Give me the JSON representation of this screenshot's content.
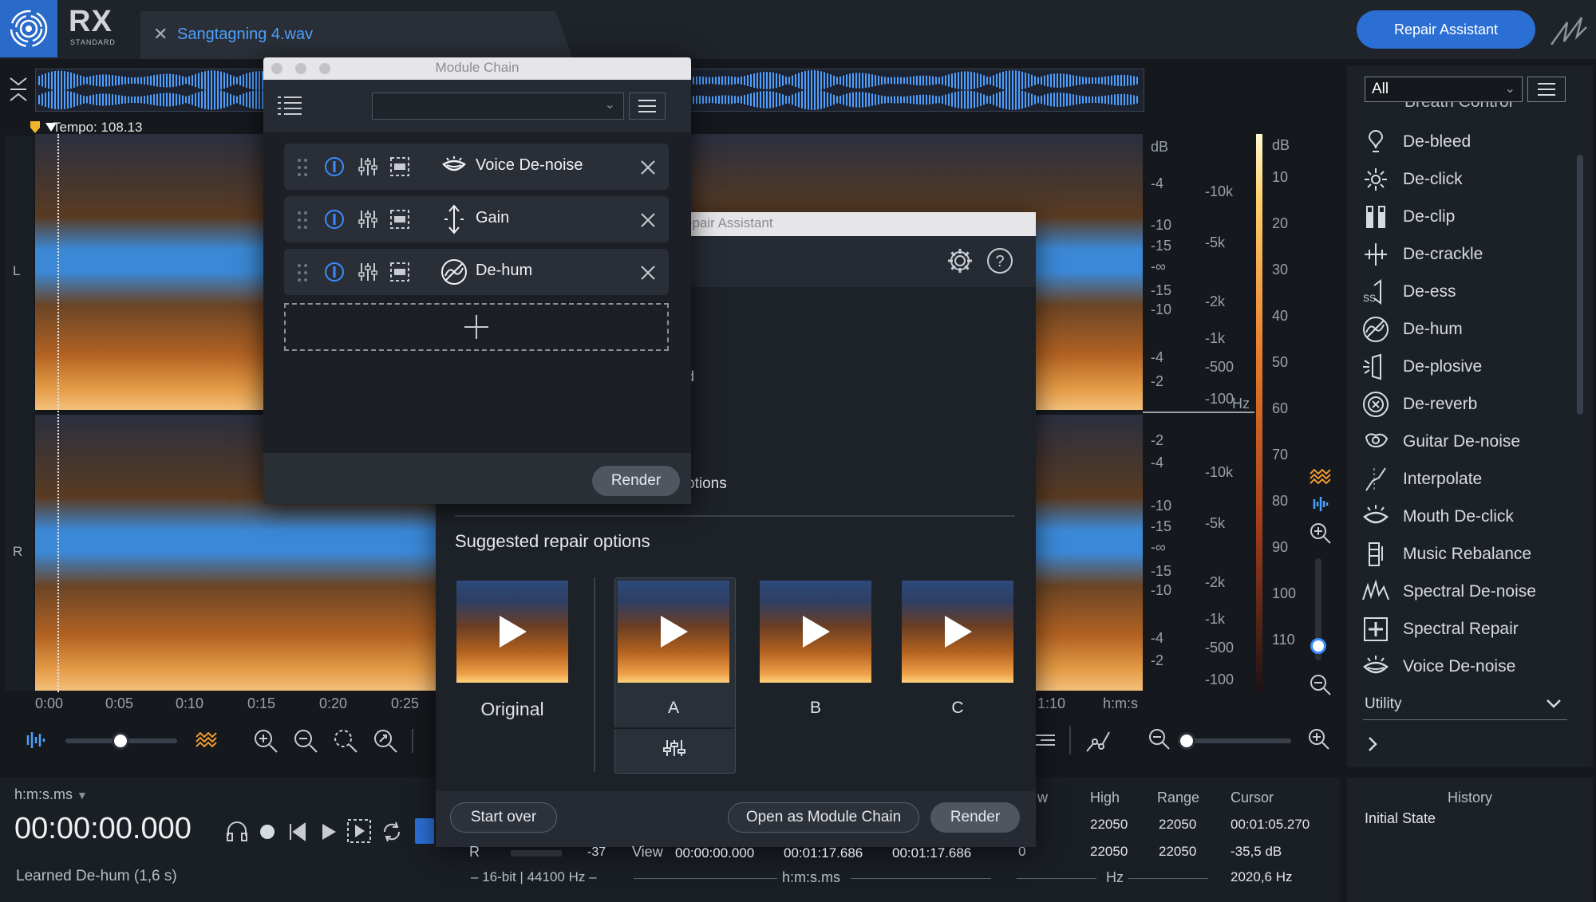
{
  "app": {
    "logo_text": "RX",
    "logo_sub": "STANDARD",
    "file_tab": "Sangtagning 4.wav",
    "repair_assistant_button": "Repair Assistant"
  },
  "editor": {
    "tempo": "Tempo: 108.13",
    "channel_left": "L",
    "channel_right": "R",
    "db_ticks_top": [
      "dB",
      "-4",
      "-10",
      "-15",
      "-∞",
      "-15",
      "-10",
      "-4",
      "-2"
    ],
    "db_ticks_bottom": [
      "-2",
      "-4",
      "-10",
      "-15",
      "-∞",
      "-15",
      "-10",
      "-4",
      "-2"
    ],
    "hz_ticks_top": [
      "-10k",
      "-5k",
      "-2k",
      "-1k",
      "-500",
      "-100"
    ],
    "hz_ticks_bottom": [
      "-10k",
      "-5k",
      "-2k",
      "-1k",
      "-500",
      "-100"
    ],
    "hz_unit": "Hz",
    "meter_ticks": [
      "dB",
      "10",
      "20",
      "30",
      "40",
      "50",
      "60",
      "70",
      "80",
      "90",
      "100",
      "110"
    ],
    "time_ticks": [
      "0:00",
      "0:05",
      "0:10",
      "0:15",
      "0:20",
      "0:25",
      "1:10"
    ],
    "time_unit": "h:m:s"
  },
  "transport": {
    "time_format": "h:m:s.ms",
    "time_display": "00:00:00.000",
    "status": "Learned De-hum (1,6 s)"
  },
  "info": {
    "r_label": "R",
    "r_value": "-37",
    "bitdepth": "16-bit | 44100 Hz",
    "view_label": "View",
    "view_start": "00:00:00.000",
    "view_end": "00:01:17.686",
    "view_len": "00:01:17.686",
    "view_unit": "h:m:s.ms",
    "low_header": "w",
    "high_header": "High",
    "range_header": "Range",
    "cursor_header": "Cursor",
    "low_row2": "0",
    "high_row1": "22050",
    "high_row2": "22050",
    "range_row1": "22050",
    "range_row2": "22050",
    "cursor_time": "00:01:05.270",
    "cursor_db": "-35,5 dB",
    "cursor_hz": "2020,6 Hz",
    "hz_unit": "Hz"
  },
  "module_list": {
    "filter": "All",
    "partial_item": "Breath Control",
    "items": [
      {
        "label": "De-bleed",
        "icon": "de-bleed-icon"
      },
      {
        "label": "De-click",
        "icon": "de-click-icon"
      },
      {
        "label": "De-clip",
        "icon": "de-clip-icon"
      },
      {
        "label": "De-crackle",
        "icon": "de-crackle-icon"
      },
      {
        "label": "De-ess",
        "icon": "de-ess-icon"
      },
      {
        "label": "De-hum",
        "icon": "de-hum-icon"
      },
      {
        "label": "De-plosive",
        "icon": "de-plosive-icon"
      },
      {
        "label": "De-reverb",
        "icon": "de-reverb-icon"
      },
      {
        "label": "Guitar De-noise",
        "icon": "guitar-de-noise-icon"
      },
      {
        "label": "Interpolate",
        "icon": "interpolate-icon"
      },
      {
        "label": "Mouth De-click",
        "icon": "mouth-de-click-icon"
      },
      {
        "label": "Music Rebalance",
        "icon": "music-rebalance-icon"
      },
      {
        "label": "Spectral De-noise",
        "icon": "spectral-de-noise-icon"
      },
      {
        "label": "Spectral Repair",
        "icon": "spectral-repair-icon"
      },
      {
        "label": "Voice De-noise",
        "icon": "voice-de-noise-icon"
      }
    ],
    "utility": "Utility"
  },
  "history": {
    "title": "History",
    "items": [
      "Initial State"
    ]
  },
  "repair_assistant": {
    "title": "epair Assistant",
    "partial_text_1": "d",
    "partial_text_2": "ptions",
    "suggested": "Suggested repair options",
    "options": [
      "Original",
      "A",
      "B",
      "C"
    ],
    "selected": "A",
    "start_over": "Start over",
    "open_module_chain": "Open as Module Chain",
    "render": "Render"
  },
  "module_chain": {
    "title": "Module Chain",
    "modules": [
      "Voice De-noise",
      "Gain",
      "De-hum"
    ],
    "render": "Render"
  }
}
